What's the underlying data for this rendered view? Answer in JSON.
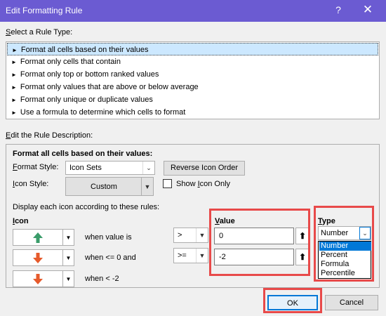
{
  "window": {
    "title": "Edit Formatting Rule",
    "help_glyph": "?",
    "close_glyph": "✕"
  },
  "rule_type": {
    "label": "Select a Rule Type:",
    "items": [
      "Format all cells based on their values",
      "Format only cells that contain",
      "Format only top or bottom ranked values",
      "Format only values that are above or below average",
      "Format only unique or duplicate values",
      "Use a formula to determine which cells to format"
    ],
    "bullet": "►",
    "selected_index": 0
  },
  "description": {
    "label": "Edit the Rule Description:",
    "heading": "Format all cells based on their values:",
    "format_style_label": "Format Style:",
    "format_style_value": "Icon Sets",
    "reverse_button": "Reverse Icon Order",
    "icon_style_label": "Icon Style:",
    "icon_style_value": "Custom",
    "show_icon_only_label": "Show Icon Only",
    "display_rules_label": "Display each icon according to these rules:",
    "icon_header": "Icon",
    "value_header": "Value",
    "type_header": "Type",
    "rows": [
      {
        "icon": "green-up-arrow",
        "icon_color": "#3a9c6a",
        "condition": "when value is",
        "operator": ">",
        "value": "0"
      },
      {
        "icon": "red-down-arrow",
        "icon_color": "#e65a2b",
        "condition": "when <= 0 and",
        "operator": ">=",
        "value": "-2"
      },
      {
        "icon": "red-down-arrow",
        "icon_color": "#e65a2b",
        "condition": "when < -2"
      }
    ],
    "type_value": "Number",
    "type_options": [
      "Number",
      "Percent",
      "Formula",
      "Percentile"
    ],
    "type_selected_index": 0
  },
  "buttons": {
    "ok": "OK",
    "cancel": "Cancel"
  },
  "colors": {
    "titlebar": "#6b5bd2",
    "highlight": "#e84a4a",
    "selection": "#0078d7"
  }
}
